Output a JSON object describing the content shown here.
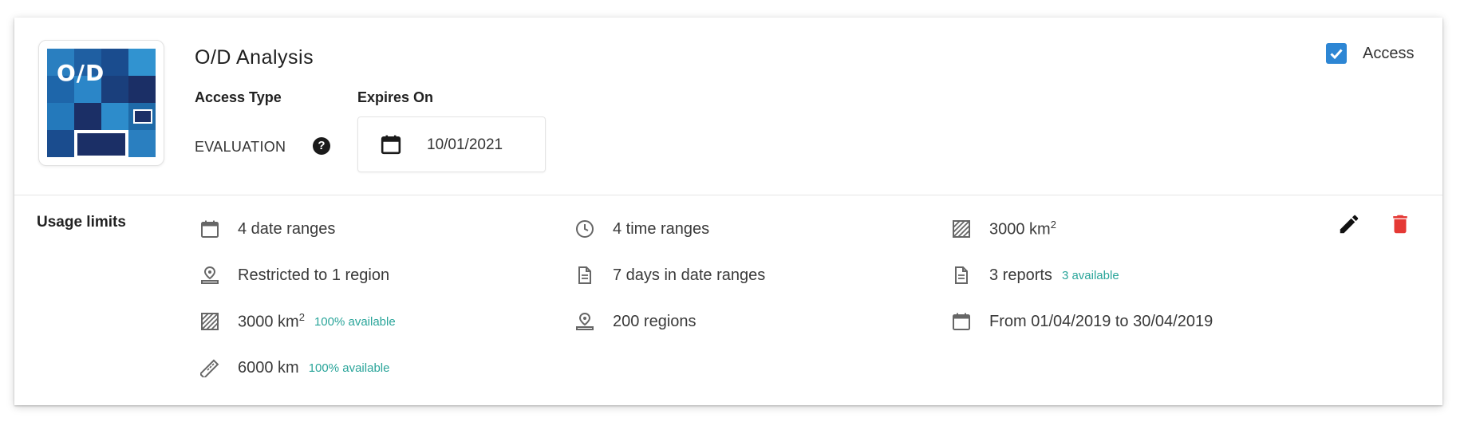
{
  "product": {
    "logo_text": "O/D",
    "title": "O/D Analysis",
    "access_type_label": "Access Type",
    "access_type_value": "EVALUATION",
    "expires_label": "Expires On",
    "expires_value": "10/01/2021",
    "access_checkbox_label": "Access",
    "access_checked": true
  },
  "usage": {
    "label": "Usage limits",
    "columns": [
      [
        {
          "icon": "calendar-icon",
          "text": "4 date ranges",
          "sup": "",
          "available": ""
        },
        {
          "icon": "location-icon",
          "text": "Restricted to 1 region",
          "sup": "",
          "available": ""
        },
        {
          "icon": "area-icon",
          "text": "3000 km",
          "sup": "2",
          "available": "100% available"
        },
        {
          "icon": "ruler-icon",
          "text": "6000 km",
          "sup": "",
          "available": "100% available"
        }
      ],
      [
        {
          "icon": "clock-icon",
          "text": "4 time ranges",
          "sup": "",
          "available": ""
        },
        {
          "icon": "document-icon",
          "text": "7 days in date ranges",
          "sup": "",
          "available": ""
        },
        {
          "icon": "location-icon",
          "text": "200 regions",
          "sup": "",
          "available": ""
        }
      ],
      [
        {
          "icon": "area-icon",
          "text": "3000 km",
          "sup": "2",
          "available": ""
        },
        {
          "icon": "document-icon",
          "text": "3 reports",
          "sup": "",
          "available": "3 available"
        },
        {
          "icon": "calendar-icon",
          "text": "From 01/04/2019 to 30/04/2019",
          "sup": "",
          "available": ""
        }
      ]
    ]
  },
  "colors": {
    "accent_blue": "#2d86d4",
    "available_teal": "#2aa59a",
    "delete_red": "#e53935",
    "logo_blue": "#1e6aa8",
    "logo_navy": "#1b2f66"
  }
}
